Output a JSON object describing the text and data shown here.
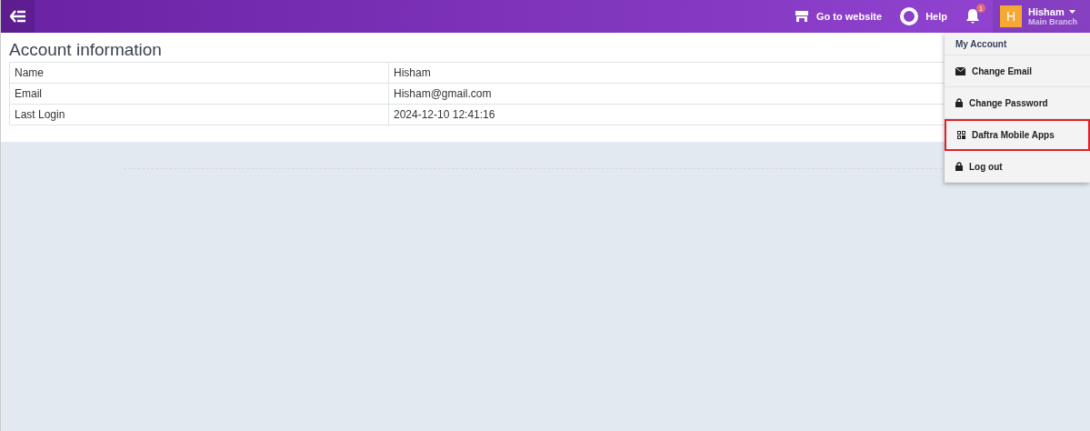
{
  "topbar": {
    "website_link": "Go to website",
    "help_link": "Help",
    "notification_count": "1",
    "user": {
      "initial": "H",
      "name": "Hisham",
      "branch": "Main Branch"
    }
  },
  "page": {
    "title": "Account information",
    "rows": [
      {
        "label": "Name",
        "value": "Hisham"
      },
      {
        "label": "Email",
        "value": "Hisham@gmail.com"
      },
      {
        "label": "Last Login",
        "value": "2024-12-10 12:41:16"
      }
    ]
  },
  "account_menu": {
    "heading": "My Account",
    "items": [
      {
        "label": "Change Email",
        "kind": "envelope",
        "selected": false
      },
      {
        "label": "Change Password",
        "kind": "lock",
        "selected": false
      },
      {
        "label": "Daftra Mobile Apps",
        "kind": "qr",
        "selected": true
      },
      {
        "label": "Log out",
        "kind": "lock",
        "selected": false
      }
    ]
  }
}
